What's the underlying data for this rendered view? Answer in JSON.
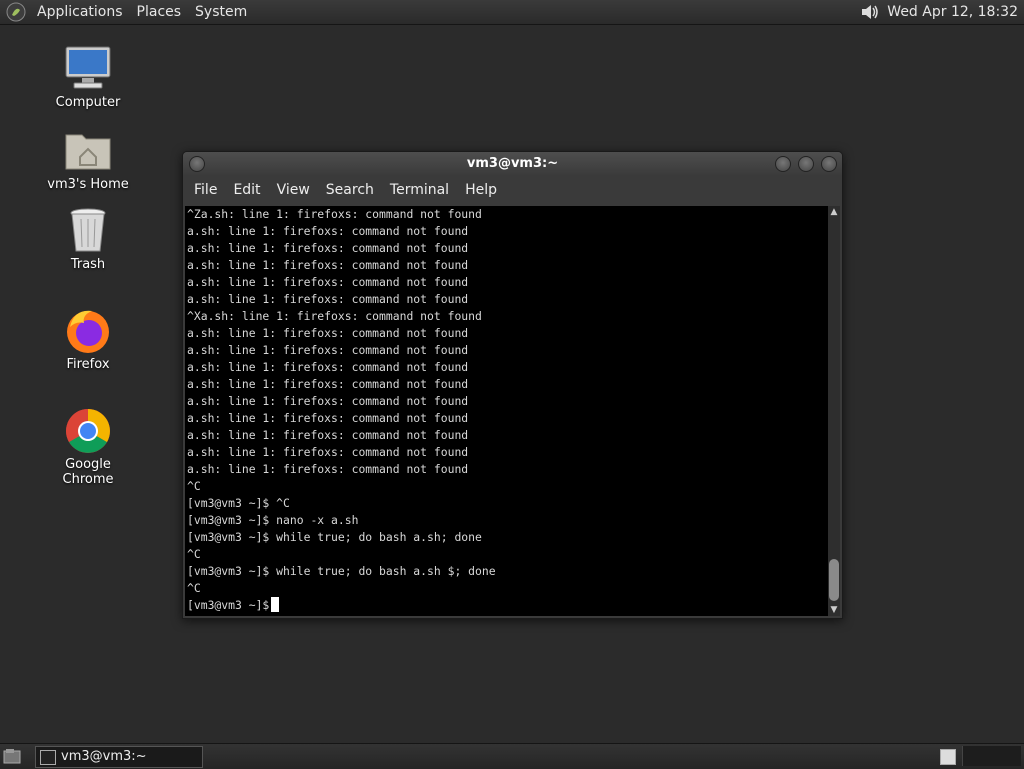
{
  "top_panel": {
    "menus": [
      "Applications",
      "Places",
      "System"
    ],
    "clock": "Wed Apr 12, 18:32",
    "icons": [
      "gnome-foot-icon",
      "speaker-icon"
    ]
  },
  "desktop_icons": [
    {
      "label": "Computer",
      "icon": "computer-icon"
    },
    {
      "label": "vm3's Home",
      "icon": "home-folder-icon"
    },
    {
      "label": "Trash",
      "icon": "trash-icon"
    },
    {
      "label": "Firefox",
      "icon": "firefox-icon"
    },
    {
      "label": "Google Chrome",
      "icon": "chrome-icon"
    }
  ],
  "terminal": {
    "title": "vm3@vm3:~",
    "menu": [
      "File",
      "Edit",
      "View",
      "Search",
      "Terminal",
      "Help"
    ],
    "lines": [
      "^Za.sh: line 1: firefoxs: command not found",
      "a.sh: line 1: firefoxs: command not found",
      "a.sh: line 1: firefoxs: command not found",
      "a.sh: line 1: firefoxs: command not found",
      "a.sh: line 1: firefoxs: command not found",
      "a.sh: line 1: firefoxs: command not found",
      "^Xa.sh: line 1: firefoxs: command not found",
      "a.sh: line 1: firefoxs: command not found",
      "a.sh: line 1: firefoxs: command not found",
      "a.sh: line 1: firefoxs: command not found",
      "a.sh: line 1: firefoxs: command not found",
      "a.sh: line 1: firefoxs: command not found",
      "a.sh: line 1: firefoxs: command not found",
      "a.sh: line 1: firefoxs: command not found",
      "a.sh: line 1: firefoxs: command not found",
      "a.sh: line 1: firefoxs: command not found",
      "^C",
      "[vm3@vm3 ~]$ ^C",
      "[vm3@vm3 ~]$ nano -x a.sh",
      "[vm3@vm3 ~]$ while true; do bash a.sh; done",
      "^C",
      "[vm3@vm3 ~]$ while true; do bash a.sh $; done",
      "^C"
    ],
    "prompt": "[vm3@vm3 ~]$ "
  },
  "bottom_panel": {
    "task_label": "vm3@vm3:~"
  },
  "colors": {
    "desktop_bg": "#2b2b2b",
    "terminal_bg": "#000000",
    "terminal_fg": "#d8d8d8"
  }
}
